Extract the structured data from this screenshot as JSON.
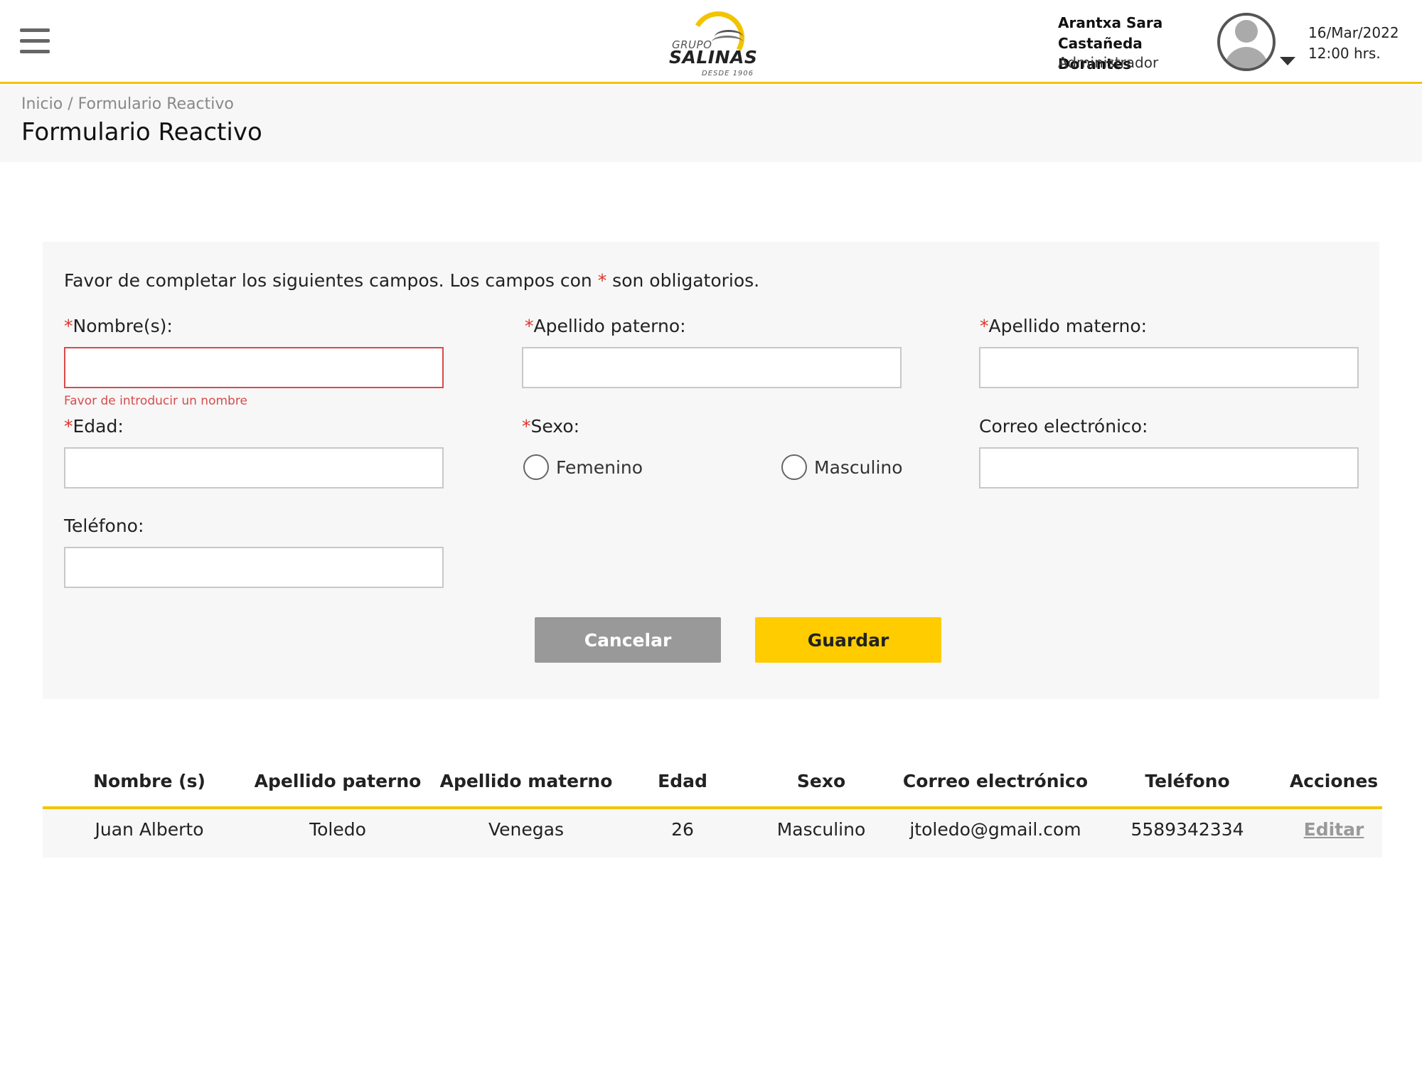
{
  "header": {
    "logo": {
      "grupo": "GRUPO",
      "salinas": "SALINAS",
      "desde": "DESDE 1906"
    },
    "user": {
      "name": "Arantxa Sara Castañeda Dorantes",
      "role": "Administrador"
    },
    "date": "16/Mar/2022",
    "time": "12:00 hrs."
  },
  "breadcrumb": {
    "home": "Inicio",
    "separator": " / ",
    "current": "Formulario Reactivo"
  },
  "page_title": "Formulario Reactivo",
  "form": {
    "intro_before": "Favor de completar los siguientes campos. Los campos con ",
    "intro_star": "*",
    "intro_after": " son obligatorios.",
    "required_mark": "*",
    "nombre_label": "Nombre(s):",
    "nombre_value": "",
    "nombre_error": "Favor de introducir un nombre",
    "paterno_label": "Apellido paterno:",
    "paterno_value": "",
    "materno_label": "Apellido materno:",
    "materno_value": "",
    "edad_label": "Edad:",
    "edad_value": "",
    "sexo_label": "Sexo:",
    "sexo_options": [
      "Femenino",
      "Masculino"
    ],
    "correo_label": "Correo electrónico:",
    "correo_value": "",
    "telefono_label": "Teléfono:",
    "telefono_value": "",
    "cancel_label": "Cancelar",
    "save_label": "Guardar"
  },
  "table": {
    "headers": [
      "Nombre (s)",
      "Apellido paterno",
      "Apellido materno",
      "Edad",
      "Sexo",
      "Correo electrónico",
      "Teléfono",
      "Acciones"
    ],
    "rows": [
      {
        "nombre": "Juan Alberto",
        "paterno": "Toledo",
        "materno": "Venegas",
        "edad": "26",
        "sexo": "Masculino",
        "correo": "jtoledo@gmail.com",
        "telefono": "5589342334",
        "accion": "Editar"
      }
    ]
  },
  "colors": {
    "accent": "#ffcc00",
    "border_accent": "#f2c400",
    "error": "#d94a4a",
    "required": "#d9362b",
    "cancel": "#999999"
  }
}
